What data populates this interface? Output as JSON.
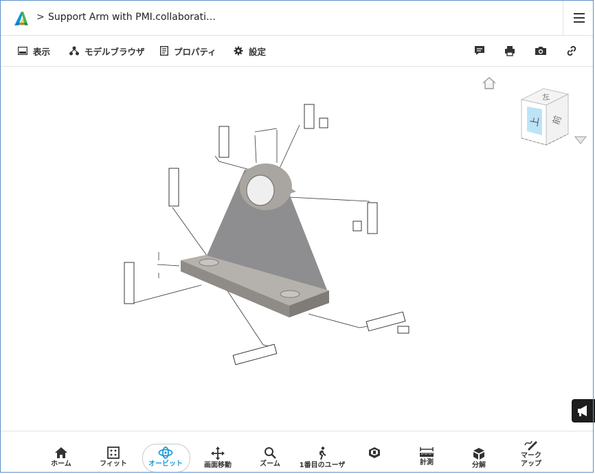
{
  "header": {
    "title": "Support Arm with PMI.collaborati…",
    "breadcrumb_separator": ">"
  },
  "toolbar": {
    "items": [
      {
        "label": "表示",
        "icon": "display-icon"
      },
      {
        "label": "モデルブラウザ",
        "icon": "model-tree-icon"
      },
      {
        "label": "プロパティ",
        "icon": "properties-icon"
      },
      {
        "label": "設定",
        "icon": "gear-icon"
      }
    ],
    "right_icons": [
      "comment-icon",
      "print-icon",
      "camera-icon",
      "link-icon"
    ]
  },
  "viewcube": {
    "front_label": "上",
    "side_label": "前",
    "top_label": "左"
  },
  "bottombar": {
    "items": [
      {
        "label": "ホーム",
        "icon": "home-icon"
      },
      {
        "label": "フィット",
        "icon": "fit-icon"
      },
      {
        "label": "オービット",
        "icon": "orbit-icon",
        "active": true
      },
      {
        "label": "画面移動",
        "icon": "pan-icon"
      },
      {
        "label": "ズーム",
        "icon": "zoom-icon"
      },
      {
        "label": "1番目のユーザ",
        "icon": "first-person-icon"
      },
      {
        "label": "",
        "icon": "section-icon"
      },
      {
        "label": "計測",
        "icon": "measure-icon"
      },
      {
        "label": "分解",
        "icon": "explode-icon"
      },
      {
        "label": "マーク アップ",
        "icon": "markup-icon"
      }
    ]
  },
  "colors": {
    "accent": "#1a9bd7",
    "model_fill": "#9a9a9a",
    "border": "#5b8fc9"
  }
}
